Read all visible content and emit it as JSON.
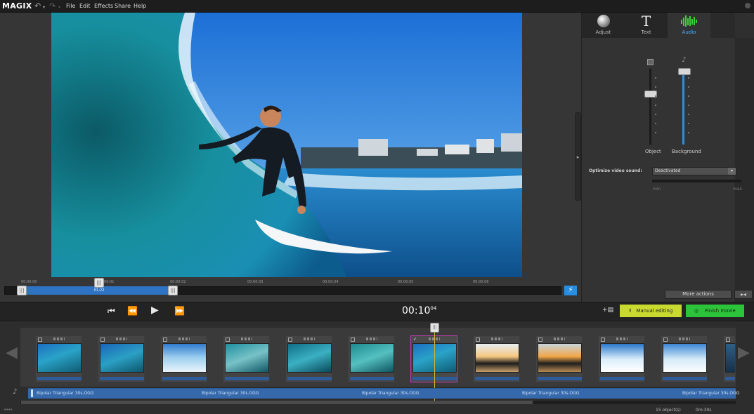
{
  "app": {
    "logo": "MAGIX"
  },
  "menu": {
    "items": [
      "File",
      "Edit",
      "Effects",
      "Share",
      "Help"
    ]
  },
  "scrubber": {
    "tick_labels": [
      "00:00:00",
      "00:00:01",
      "00:00:02",
      "00:00:03",
      "00:00:04",
      "00:00:05",
      "00:00:06"
    ],
    "handle_time": "01:22"
  },
  "panel": {
    "tabs": [
      {
        "label": "Adjust",
        "icon": "sphere-icon"
      },
      {
        "label": "Text",
        "icon": "text-T-icon"
      },
      {
        "label": "Audio",
        "icon": "waveform-icon"
      }
    ],
    "active_tab": "Audio",
    "object_label": "Object",
    "background_label": "Background",
    "optimize_label": "Optimize video sound:",
    "optimize_value": "Deactivated",
    "min_label": "min",
    "max_label": "max",
    "more_actions": "More actions"
  },
  "transport": {
    "timecode_main": "00:10",
    "timecode_frames": "04",
    "manual_editing": "Manual editing",
    "finish_movie": "Finish movie"
  },
  "storyboard": {
    "audio_clips": [
      "Bipolar Triangular 30s.OGG",
      "Bipolar Triangular 30s.OGG",
      "Bipolar Triangular 30s.OGG",
      "Bipolar Triangular 30s.OGG",
      "Bipolar Triangular 30s.OGG"
    ],
    "objects_count": "15 object(s)",
    "duration": "0m:30s",
    "selected_index": 6
  },
  "colors": {
    "accent_blue": "#2f73c4",
    "manual_editing_bg": "#c8d92f",
    "finish_movie_bg": "#2bc43a",
    "selected_border": "#c23bb0",
    "audio_active": "#3ecf3e"
  }
}
